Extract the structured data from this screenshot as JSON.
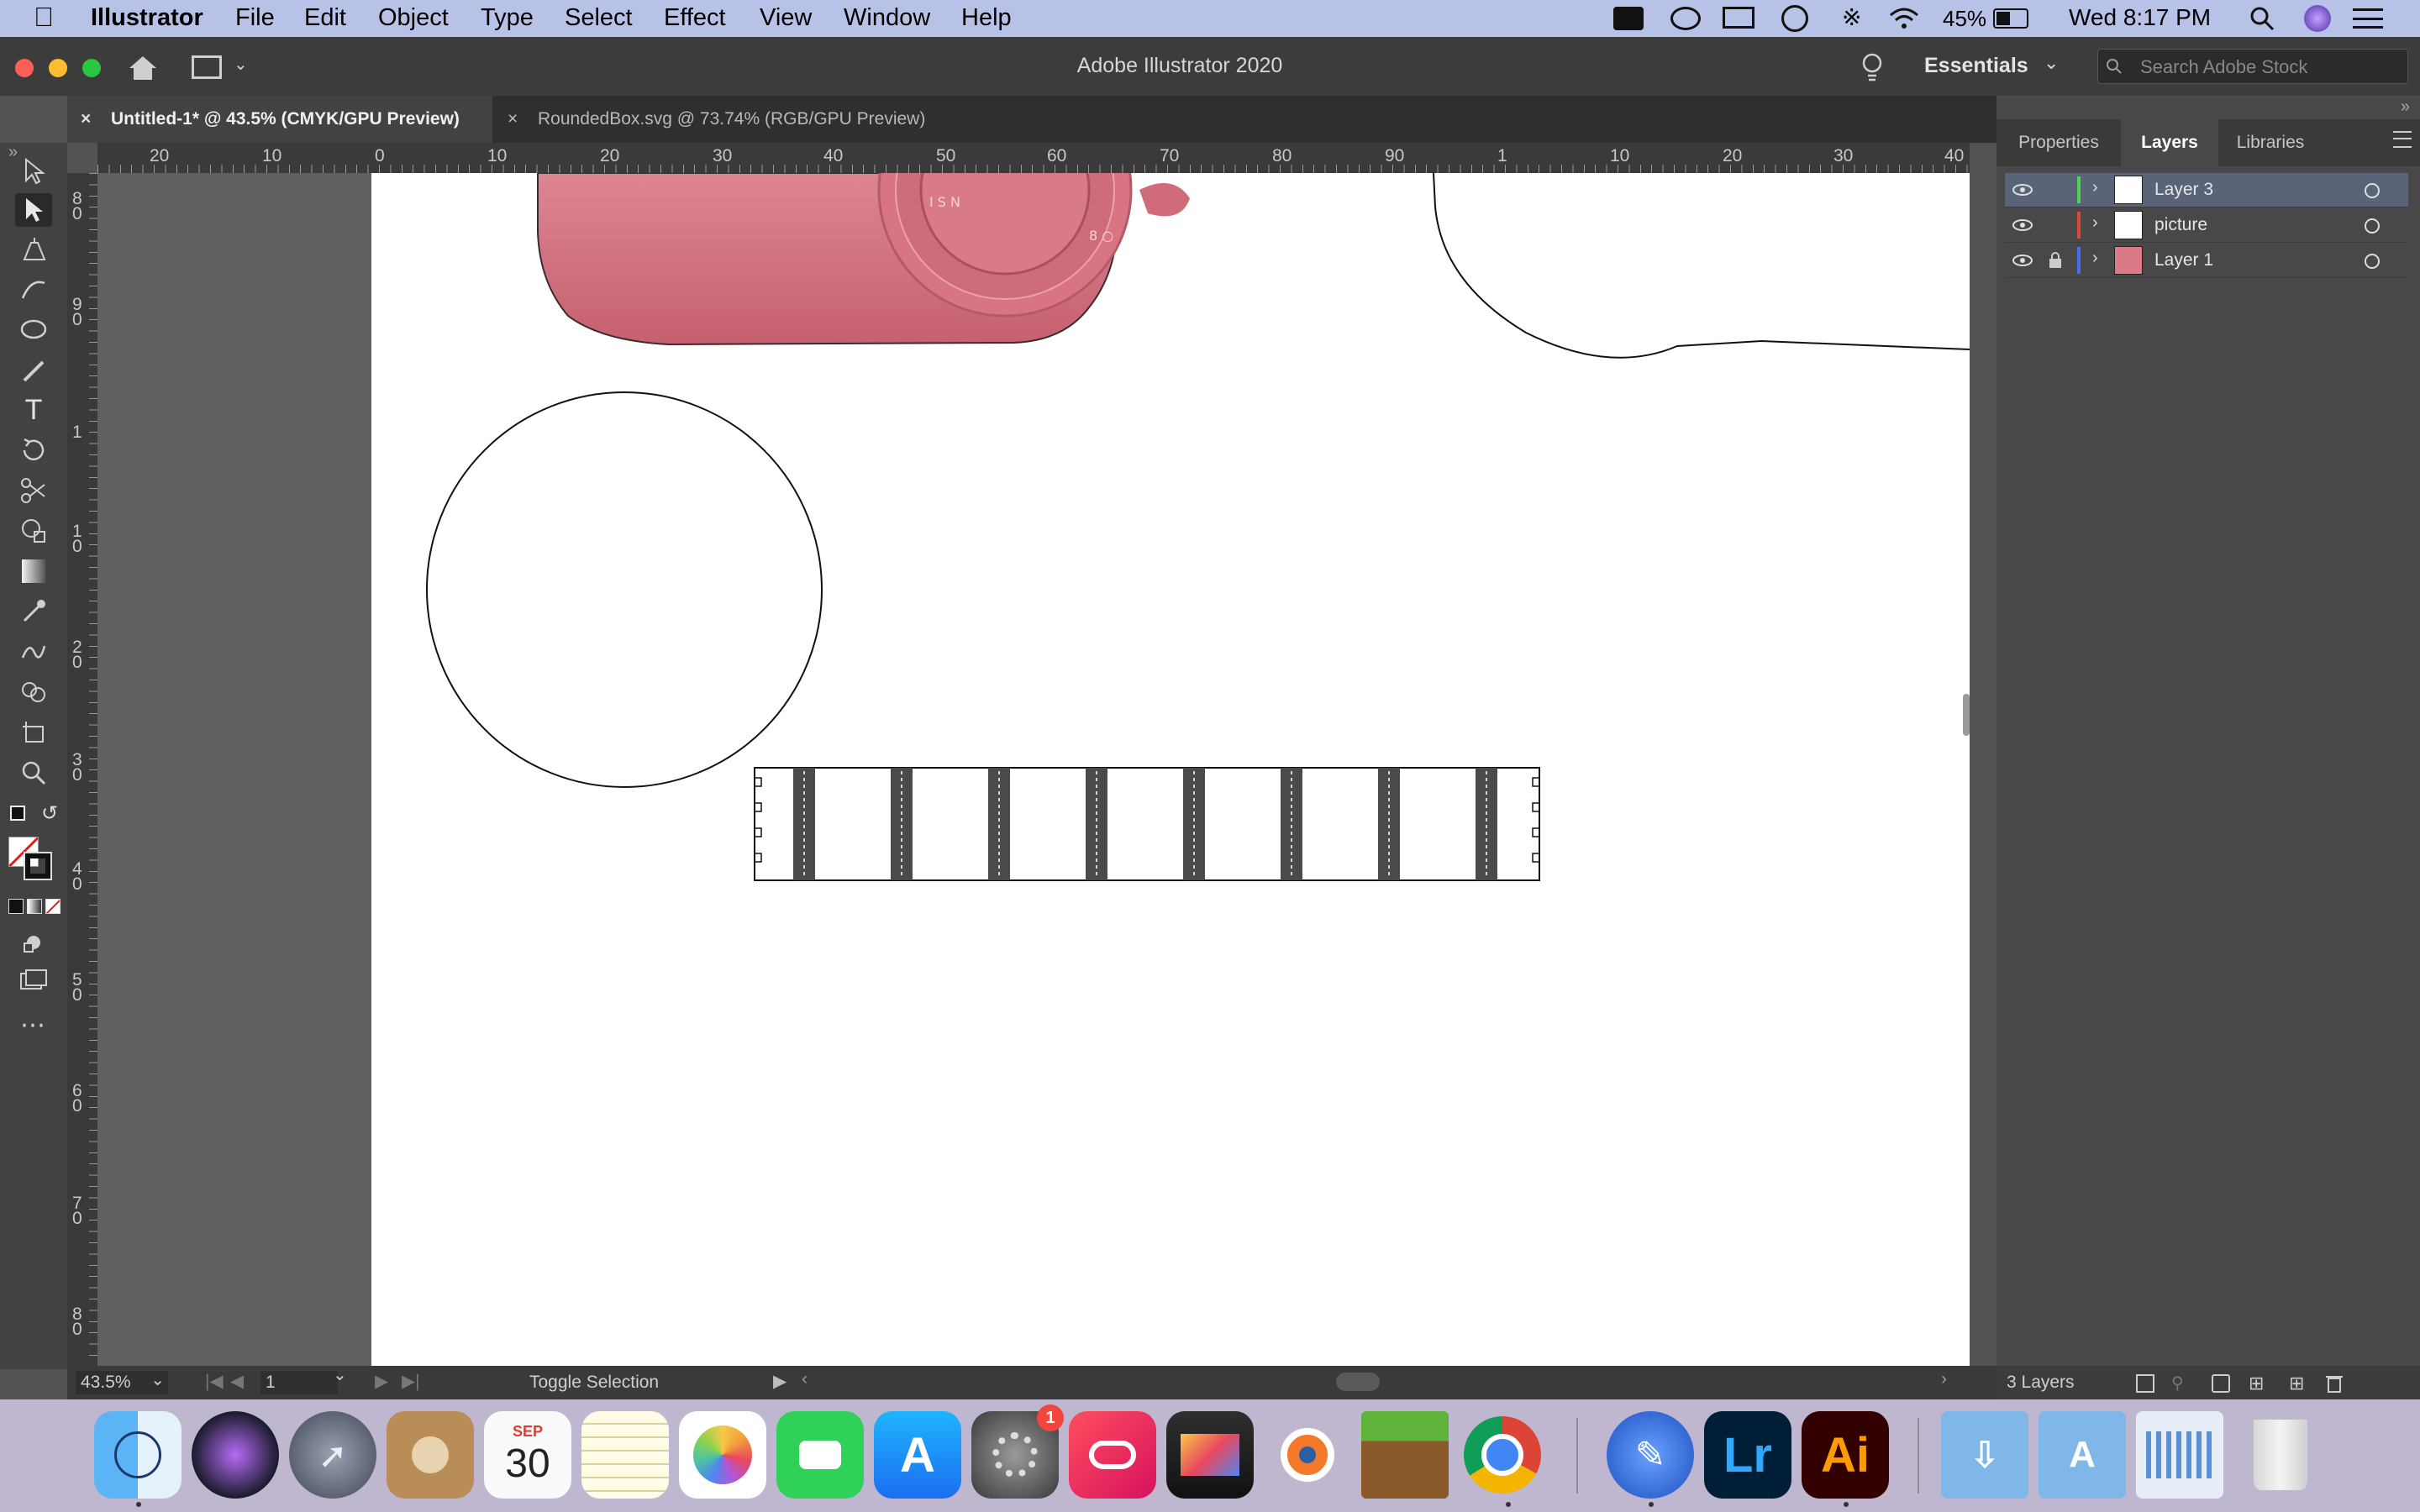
{
  "menubar": {
    "app_name": "Illustrator",
    "items": [
      "File",
      "Edit",
      "Object",
      "Type",
      "Select",
      "Effect",
      "View",
      "Window",
      "Help"
    ],
    "battery": "45%",
    "clock": "Wed 8:17 PM"
  },
  "titlebar": {
    "title": "Adobe Illustrator 2020",
    "workspace": "Essentials",
    "stock_search_placeholder": "Search Adobe Stock"
  },
  "tabs": [
    {
      "label": "Untitled-1* @ 43.5% (CMYK/GPU Preview)",
      "active": true
    },
    {
      "label": "RoundedBox.svg @ 73.74% (RGB/GPU Preview)",
      "active": false
    }
  ],
  "ruler": {
    "top_ticks": [
      "20",
      "10",
      "0",
      "10",
      "20",
      "30",
      "40",
      "50",
      "60",
      "70",
      "80",
      "90",
      "1",
      "10",
      "20",
      "30",
      "40"
    ],
    "left_ticks": [
      "8\n0",
      "9\n0",
      "1",
      "1\n0",
      "2\n0",
      "3\n0",
      "4\n0",
      "5\n0",
      "6\n0",
      "7\n0",
      "8\n0"
    ]
  },
  "panel": {
    "tabs": [
      "Properties",
      "Layers",
      "Libraries"
    ],
    "active_tab": "Layers",
    "layers": [
      {
        "name": "Layer 3",
        "color": "#4fd44f",
        "selected": true,
        "locked": false
      },
      {
        "name": "picture",
        "color": "#e0453b",
        "selected": false,
        "locked": false
      },
      {
        "name": "Layer 1",
        "color": "#4a6cf0",
        "selected": false,
        "locked": true
      }
    ],
    "footer_count": "3 Layers"
  },
  "statusbar": {
    "zoom": "43.5%",
    "artboard_number": "1",
    "status_text": "Toggle Selection"
  },
  "dock": {
    "calendar_month": "SEP",
    "calendar_day": "30",
    "prefs_badge": "1",
    "lightroom_label": "Lr",
    "illustrator_label": "Ai"
  },
  "colors": {
    "accent_selection": "#5a6478",
    "artboard": "#ffffff",
    "camera_pink": "#d97a86"
  }
}
